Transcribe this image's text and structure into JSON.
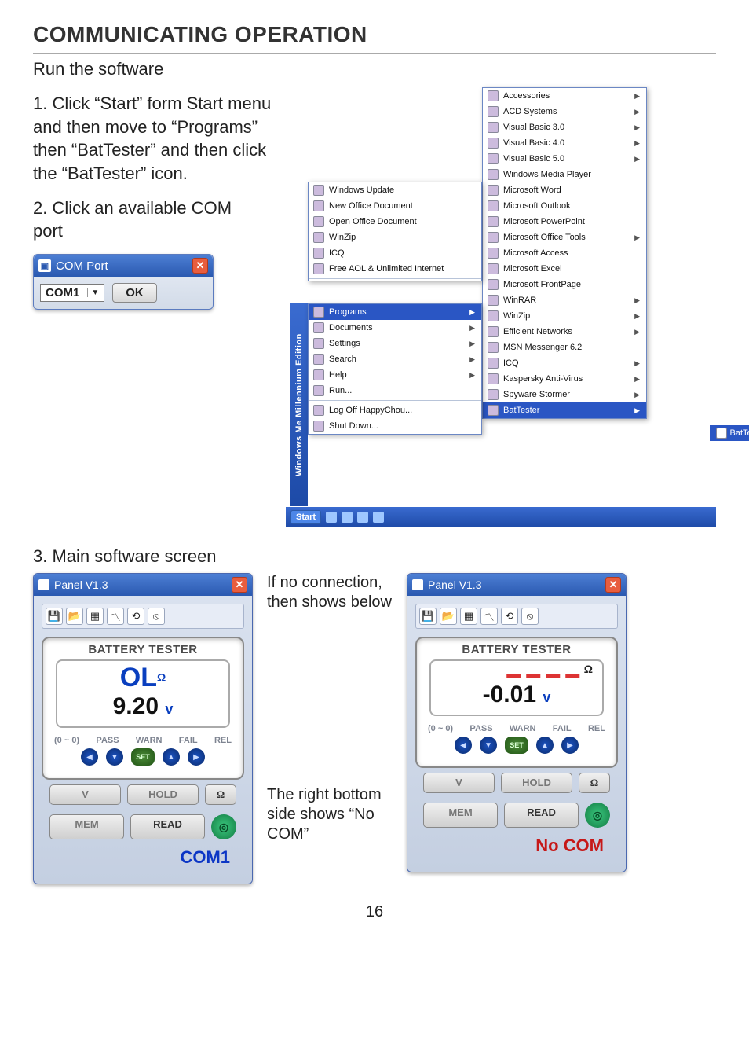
{
  "heading": "COMMUNICATING OPERATION",
  "subhead": "Run the software",
  "step1": "1. Click “Start” form Start menu and then move to “Programs” then “BatTester” and then click the “BatTester” icon.",
  "step2": "2. Click an available COM port",
  "com_dialog": {
    "title": "COM Port",
    "value": "COM1",
    "ok": "OK"
  },
  "start_menu": {
    "sidebar": "Windows Me Millennium Edition",
    "top_items": [
      "Windows Update",
      "New Office Document",
      "Open Office Document",
      "WinZip",
      "ICQ",
      "Free AOL & Unlimited Internet"
    ],
    "main_items": [
      "Programs",
      "Documents",
      "Settings",
      "Search",
      "Help",
      "Run...",
      "Log Off HappyChou...",
      "Shut Down..."
    ],
    "hl_main": 0,
    "programs": [
      "Accessories",
      "ACD Systems",
      "Visual Basic 3.0",
      "Visual Basic 4.0",
      "Visual Basic 5.0",
      "Windows Media Player",
      "Microsoft Word",
      "Microsoft Outlook",
      "Microsoft PowerPoint",
      "Microsoft Office Tools",
      "Microsoft Access",
      "Microsoft Excel",
      "Microsoft FrontPage",
      "WinRAR",
      "WinZip",
      "Efficient Networks",
      "MSN Messenger 6.2",
      "ICQ",
      "Kaspersky Anti-Virus",
      "Spyware Stormer",
      "BatTester"
    ],
    "hl_prog": 20,
    "flyout": "BatTester",
    "taskbar": {
      "start": "Start"
    }
  },
  "step3": "3. Main software screen",
  "panel": {
    "title": "Panel  V1.3",
    "tester_h": "BATTERY TESTER",
    "ol": "OL",
    "ohm_suffix": "Ω",
    "volts_ok": "9.20",
    "volts_bad": "-0.01",
    "v_suffix": "v",
    "labels": [
      "(0 ~ 0)",
      "PASS",
      "WARN",
      "FAIL",
      "REL"
    ],
    "set_btn": "SET",
    "btns": {
      "v": "V",
      "hold": "HOLD",
      "ohm": "Ω",
      "mem": "MEM",
      "read": "READ"
    },
    "com1": "COM1",
    "nocom": "No COM"
  },
  "note_top": "If no connection, then shows below",
  "note_bot": "The right bottom side shows  “No COM”",
  "page_num": "16"
}
